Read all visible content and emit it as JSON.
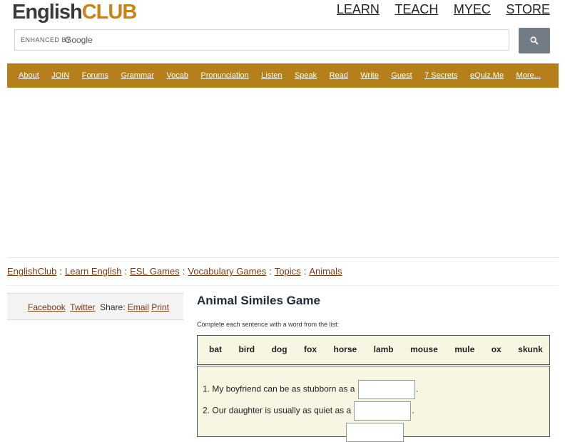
{
  "logo": {
    "english": "English",
    "club": "CLUB"
  },
  "topnav": [
    "LEARN",
    "TEACH",
    "MYEC",
    "STORE"
  ],
  "search": {
    "enhanced_by": "ENHANCED BY",
    "google": "Google",
    "value": ""
  },
  "mainnav": [
    "About",
    "JOIN",
    "Forums",
    "Grammar",
    "Vocab",
    "Pronunciation",
    "Listen",
    "Speak",
    "Read",
    "Write",
    "Guest",
    "7 Secrets",
    "eQuiz.Me",
    "More..."
  ],
  "breadcrumb": [
    "EnglishClub",
    "Learn English",
    "ESL Games",
    "Vocabulary Games",
    "Topics",
    "Animals"
  ],
  "share": {
    "facebook": "Facebook",
    "twitter": "Twitter",
    "label": "Share:",
    "email": "Email",
    "print": "Print"
  },
  "game": {
    "title": "Animal Similes Game",
    "instructions": "Complete each sentence with a word from the list:",
    "words": [
      "bat",
      "bird",
      "dog",
      "fox",
      "horse",
      "lamb",
      "mouse",
      "mule",
      "ox",
      "skunk"
    ],
    "questions": [
      {
        "num": "1.",
        "before": "My boyfriend can be as stubborn as a",
        "after": ".",
        "value": ""
      },
      {
        "num": "2.",
        "before": "Our daughter is usually as quiet as a",
        "after": ".",
        "value": ""
      }
    ]
  },
  "colors": {
    "nav_bg": "#b57f1c",
    "link": "#7a3a12",
    "box_bg": "#f6f6e2",
    "logo_club": "#c88418"
  }
}
